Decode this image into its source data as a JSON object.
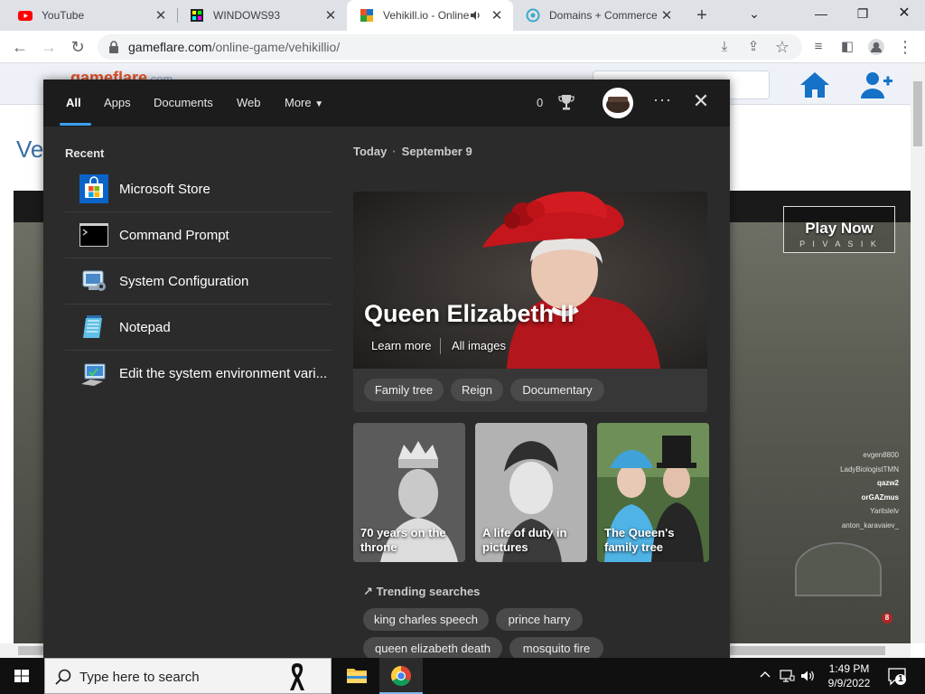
{
  "browser": {
    "tabs": [
      {
        "title": "YouTube",
        "icon": "youtube-icon",
        "active": false
      },
      {
        "title": "WINDOWS93",
        "icon": "windows93-icon",
        "active": false
      },
      {
        "title": "Vehikill.io - Online",
        "icon": "gameflare-icon",
        "active": true,
        "audio": true
      },
      {
        "title": "Domains + Commerce",
        "icon": "domains-icon",
        "active": false
      }
    ],
    "new_tab_label": "+",
    "url_host": "gameflare.com",
    "url_path": "/online-game/vehikillio/"
  },
  "site": {
    "logo": "gameflare",
    "logo_suffix": ".com",
    "title_peek": "Ve",
    "play_now": {
      "label": "Play Now",
      "sub": "P I V A S I K"
    },
    "leaderboard": [
      "evgen8800",
      "LadyBiologistTMN",
      "qazw2",
      "orGAZmus",
      "Yaritslelv",
      "anton_karavaiev_"
    ],
    "minimap_badge": "8",
    "colors": {
      "brand_blue": "#1672c6",
      "logo_orange": "#e8532a"
    }
  },
  "flyout": {
    "tabs": [
      "All",
      "Apps",
      "Documents",
      "Web",
      "More"
    ],
    "active_tab": "All",
    "points": "0",
    "recent_title": "Recent",
    "recent": [
      {
        "label": "Microsoft Store",
        "icon": "microsoft-store-icon"
      },
      {
        "label": "Command Prompt",
        "icon": "command-prompt-icon"
      },
      {
        "label": "System Configuration",
        "icon": "system-configuration-icon"
      },
      {
        "label": "Notepad",
        "icon": "notepad-icon"
      },
      {
        "label": "Edit the system environment vari...",
        "icon": "system-properties-icon"
      }
    ],
    "today_label": "Today",
    "date_label": "September 9",
    "hero": {
      "title": "Queen Elizabeth II",
      "learn_more": "Learn more",
      "all_images": "All images",
      "chips": [
        "Family tree",
        "Reign",
        "Documentary"
      ]
    },
    "cards": [
      {
        "caption": "70 years on the throne"
      },
      {
        "caption": "A life of duty in pictures"
      },
      {
        "caption": "The Queen's family tree"
      }
    ],
    "trending_title": "Trending searches",
    "trending": [
      "king charles speech",
      "prince harry",
      "queen elizabeth death",
      "mosquito fire"
    ],
    "accent": "#3aa0f3"
  },
  "taskbar": {
    "search_placeholder": "Type here to search",
    "time": "1:49 PM",
    "date": "9/9/2022",
    "notification_count": "1"
  }
}
